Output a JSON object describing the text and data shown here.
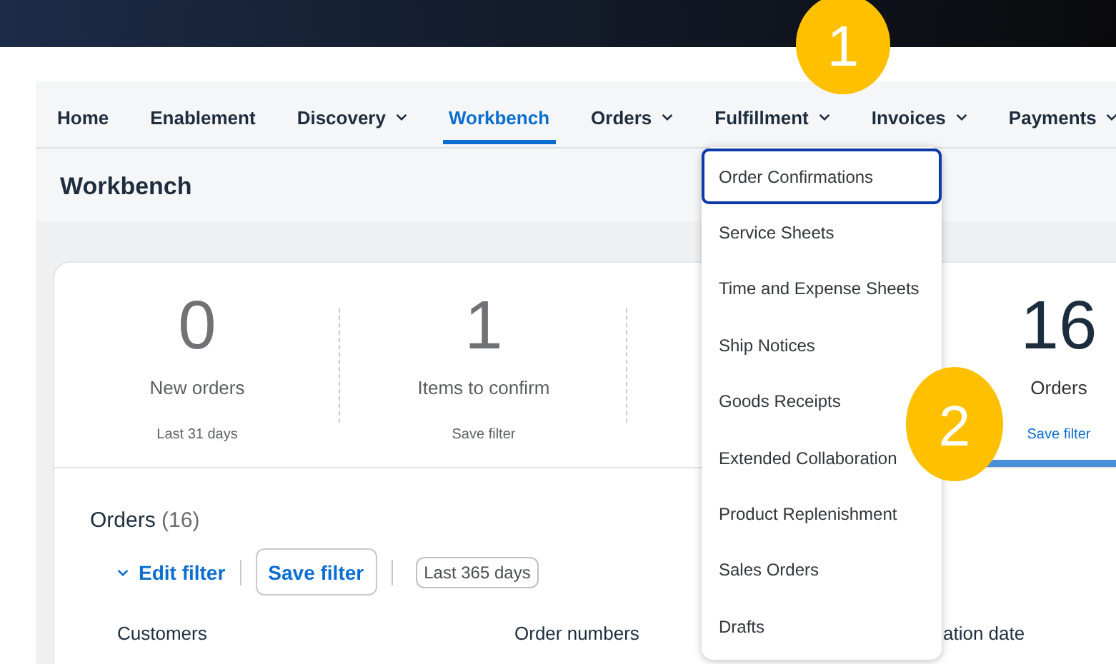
{
  "nav": {
    "items": [
      {
        "label": "Home",
        "menu": false,
        "selected": false
      },
      {
        "label": "Enablement",
        "menu": false,
        "selected": false
      },
      {
        "label": "Discovery",
        "menu": true,
        "selected": false
      },
      {
        "label": "Workbench",
        "menu": false,
        "selected": true
      },
      {
        "label": "Orders",
        "menu": true,
        "selected": false
      },
      {
        "label": "Fulfillment",
        "menu": true,
        "selected": false
      },
      {
        "label": "Invoices",
        "menu": true,
        "selected": false
      },
      {
        "label": "Payments",
        "menu": true,
        "selected": false
      }
    ]
  },
  "page_title": "Workbench",
  "tiles": [
    {
      "value": "0",
      "label": "New orders",
      "footer": "Last 31 days",
      "footer_link": false,
      "selected": false
    },
    {
      "value": "1",
      "label": "Items to confirm",
      "footer": "Save filter",
      "footer_link": false,
      "selected": false
    },
    {
      "value": "16",
      "label": "Orders",
      "footer": "Save filter",
      "footer_link": true,
      "selected": true
    }
  ],
  "orders": {
    "title": "Orders",
    "count": "(16)",
    "edit_filter": "Edit filter",
    "save_filter": "Save filter",
    "date_range": "Last 365 days",
    "columns": [
      "Customers",
      "Order numbers",
      "ation date"
    ]
  },
  "dropdown": {
    "items": [
      {
        "label": "Order Confirmations",
        "selected": true
      },
      {
        "label": "Service Sheets",
        "selected": false
      },
      {
        "label": "Time and Expense Sheets",
        "selected": false
      },
      {
        "label": "Ship Notices",
        "selected": false
      },
      {
        "label": "Goods Receipts",
        "selected": false
      },
      {
        "label": "Extended Collaboration",
        "selected": false
      },
      {
        "label": "Product Replenishment",
        "selected": false
      },
      {
        "label": "Sales Orders",
        "selected": false
      },
      {
        "label": "Drafts",
        "selected": false
      }
    ]
  },
  "markers": [
    {
      "label": "1"
    },
    {
      "label": "2"
    }
  ]
}
